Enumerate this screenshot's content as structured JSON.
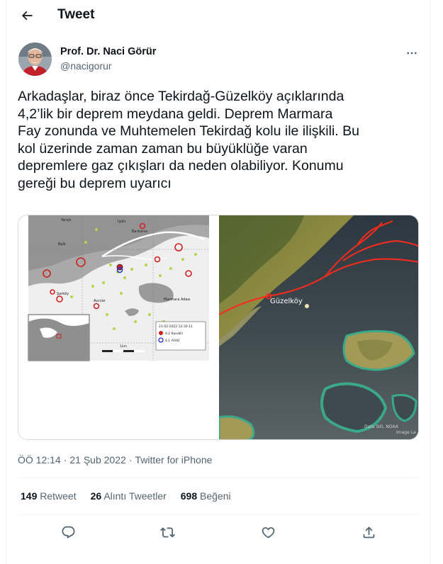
{
  "header": {
    "title": "Tweet"
  },
  "author": {
    "name": "Prof. Dr. Naci Görür",
    "handle": "@nacigorur"
  },
  "tweet": {
    "text": "Arkadaşlar, biraz önce Tekirdağ-Güzelköy açıklarında\n4,2’lik bir deprem meydana geldi. Deprem Marmara\nFay zonunda ve Muhtemelen Tekirdağ kolu ile ilişkili. Bu\nkol üzerinde zaman zaman bu büyüklüğe varan\ndepremlere gaz çıkışları da neden olabiliyor. Konumu\ngereği bu deprem uyarıcı"
  },
  "media": {
    "map_labels": {
      "place1": "Yarışlı",
      "place2": "Işıklı",
      "place3": "Barbaros",
      "place4": "Balk",
      "place5": "Avcılar",
      "place6": "Şarköy",
      "place7": "Marmara Adası",
      "legend_date": "21-02-2022 12:30:11",
      "legend_item1": "4.2 Kandilli",
      "legend_item2": "4.1 AFAD",
      "scale": "1km"
    },
    "photo_label": "Güzelköy",
    "photo_credit_line1": "Data SIO, NOAA",
    "photo_credit_line2": "Image La"
  },
  "meta": {
    "time": "ÖÖ 12:14",
    "date": "21 Şub 2022",
    "source": "Twitter for iPhone",
    "sep": "·"
  },
  "stats": [
    {
      "count": "149",
      "label": "Retweet"
    },
    {
      "count": "26",
      "label": "Alıntı Tweetler"
    },
    {
      "count": "698",
      "label": "Beğeni"
    }
  ],
  "colors": {
    "fault_line": "#ff2a1a",
    "muted": "#536471",
    "text": "#0f1419"
  }
}
